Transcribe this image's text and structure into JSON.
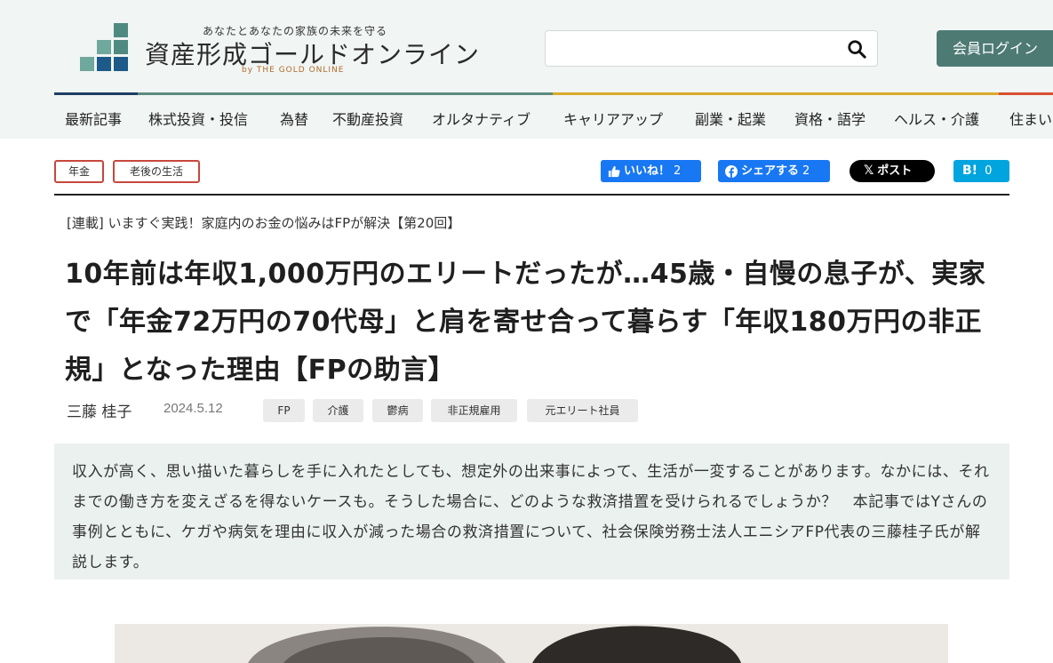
{
  "header": {
    "tagline": "あなたとあなたの家族の未来を守る",
    "site_name": "資産形成ゴールドオンライン",
    "site_sub": "by THE GOLD ONLINE",
    "search_value": "",
    "search_placeholder": "",
    "login_label": "会員ログイン",
    "colors": {
      "background": "#f1f5f3",
      "brand": "#4d7b74"
    }
  },
  "nav": {
    "items": [
      "最新記事",
      "株式投資・投信",
      "為替",
      "不動産投資",
      "オルタナティブ",
      "キャリアアップ",
      "副業・起業",
      "資格・語学",
      "ヘルス・介護",
      "住まい"
    ]
  },
  "article": {
    "categories": [
      "年金",
      "老後の生活"
    ],
    "share": {
      "like_label": "いいね！",
      "like_count": "2",
      "share_label": "シェアする",
      "share_count": "2",
      "post_label": "ポスト",
      "hatena_label": "B!",
      "hatena_count": "0"
    },
    "series": "[連載] いますぐ実践！家庭内のお金の悩みはFPが解決【第20回】",
    "title": "10年前は年収1,000万円のエリートだったが…45歳・自慢の息子が、実家で「年金72万円の70代母」と肩を寄せ合って暮らす「年収180万円の非正規」となった理由【FPの助言】",
    "author": "三藤 桂子",
    "date": "2024.5.12",
    "keywords": [
      "FP",
      "介護",
      "鬱病",
      "非正規雇用",
      "元エリート社員"
    ],
    "lead": "収入が高く、思い描いた暮らしを手に入れたとしても、想定外の出来事によって、生活が一変することがあります。なかには、それまでの働き方を変えざるを得ないケースも。そうした場合に、どのような救済措置を受けられるでしょうか？　本記事ではYさんの事例とともに、ケガや病気を理由に収入が減った場合の救済措置について、社会保険労務士法人エニシアFP代表の三藤桂子氏が解説します。"
  }
}
